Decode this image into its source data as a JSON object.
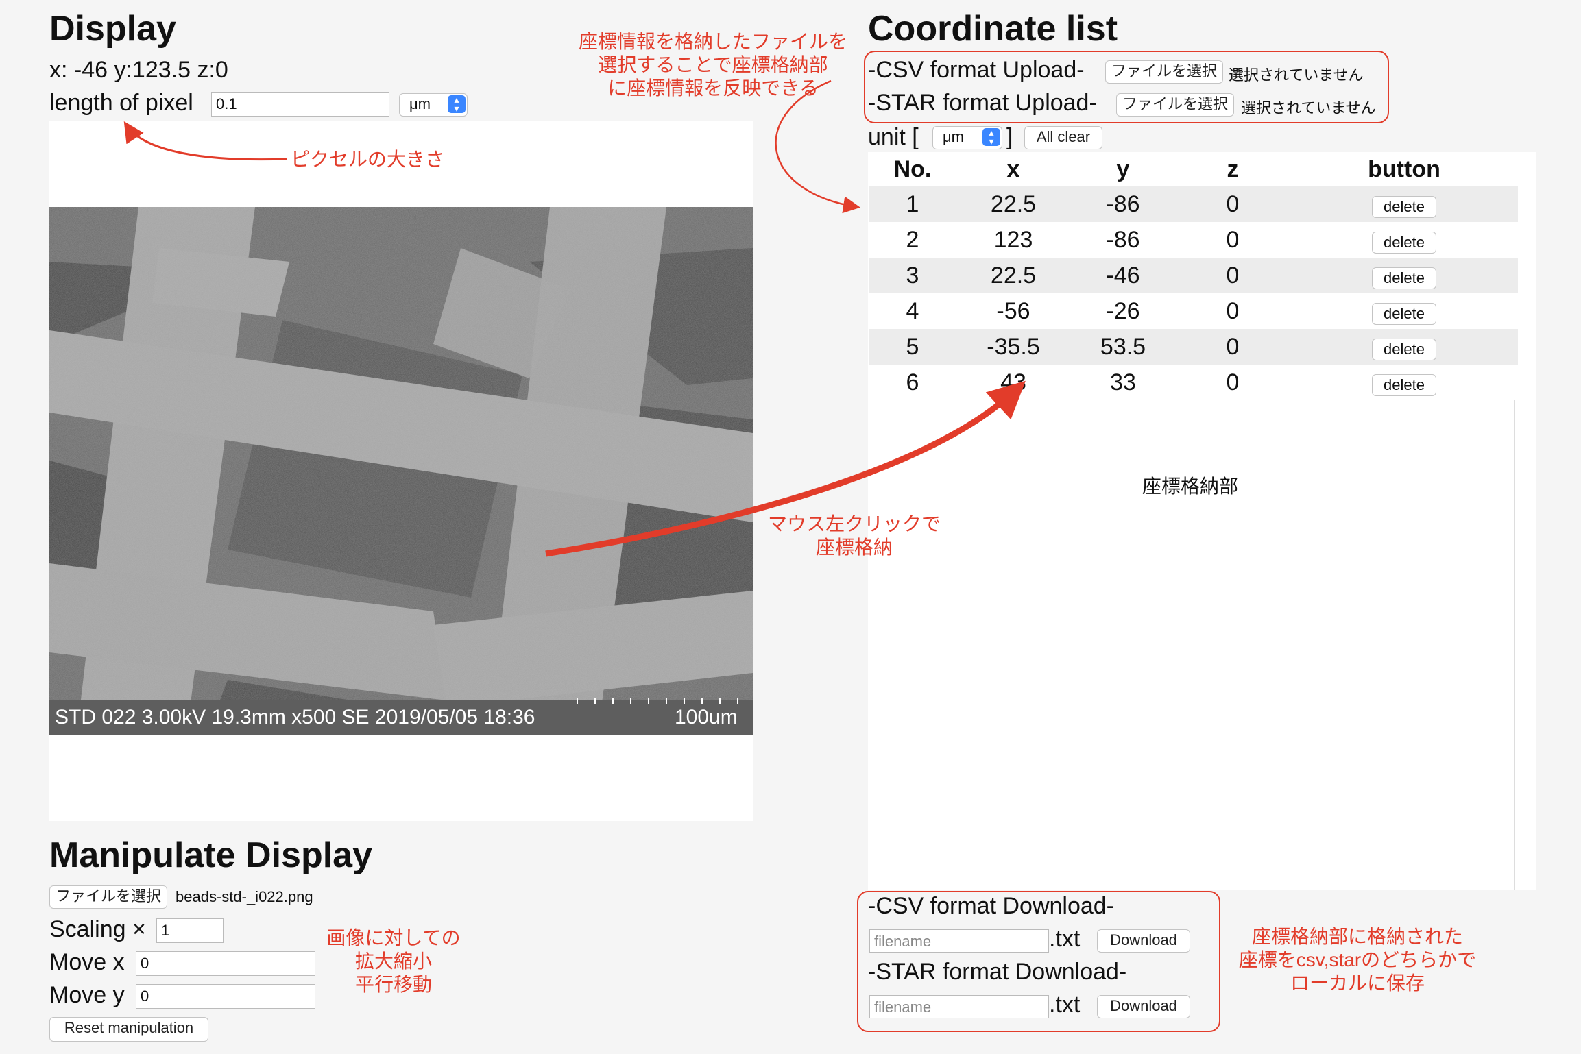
{
  "display": {
    "title": "Display",
    "coord_readout": "x: -46 y:123.5 z:0",
    "pixel_label": "length of pixel",
    "pixel_value": "0.1",
    "pixel_unit": "μm",
    "sem_caption": "STD 022 3.00kV 19.3mm x500 SE  2019/05/05 18:36",
    "sem_scale": "100um"
  },
  "manipulate": {
    "title": "Manipulate Display",
    "file_button": "ファイルを選択",
    "file_name": "beads-std-_i022.png",
    "scaling_label": "Scaling ×",
    "scaling_value": "1",
    "move_x_label": "Move x",
    "move_x_value": "0",
    "move_y_label": "Move y",
    "move_y_value": "0",
    "reset_button": "Reset manipulation"
  },
  "coordinate_list": {
    "title": "Coordinate list",
    "csv_upload_label": "-CSV format Upload-",
    "star_upload_label": "-STAR format Upload-",
    "file_button": "ファイルを選択",
    "no_file": "選択されていません",
    "unit_label": "unit [",
    "unit_close": "]",
    "unit_value": "μm",
    "all_clear": "All clear",
    "headers": [
      "No.",
      "x",
      "y",
      "z",
      "button"
    ],
    "rows": [
      {
        "no": "1",
        "x": "22.5",
        "y": "-86",
        "z": "0",
        "btn": "delete"
      },
      {
        "no": "2",
        "x": "123",
        "y": "-86",
        "z": "0",
        "btn": "delete"
      },
      {
        "no": "3",
        "x": "22.5",
        "y": "-46",
        "z": "0",
        "btn": "delete"
      },
      {
        "no": "4",
        "x": "-56",
        "y": "-26",
        "z": "0",
        "btn": "delete"
      },
      {
        "no": "5",
        "x": "-35.5",
        "y": "53.5",
        "z": "0",
        "btn": "delete"
      },
      {
        "no": "6",
        "x": "43",
        "y": "33",
        "z": "0",
        "btn": "delete"
      }
    ],
    "storage_label": "座標格納部"
  },
  "download": {
    "csv_label": "-CSV format Download-",
    "star_label": "-STAR format Download-",
    "filename_placeholder": "filename",
    "ext": ".txt",
    "button": "Download"
  },
  "annotations": {
    "upload_note": [
      "座標情報を格納したファイルを",
      "選択することで座標格納部",
      "に座標情報を反映できる"
    ],
    "pixel_note": "ピクセルの大きさ",
    "click_note": [
      "マウス左クリックで",
      "座標格納"
    ],
    "scale_note": [
      "画像に対しての",
      "拡大縮小",
      "平行移動"
    ],
    "download_note": [
      "座標格納部に格納された",
      "座標をcsv,starのどちらかで",
      "ローカルに保存"
    ]
  },
  "colors": {
    "annotation_red": "#e23c2a",
    "select_accent": "#3a86ff"
  }
}
